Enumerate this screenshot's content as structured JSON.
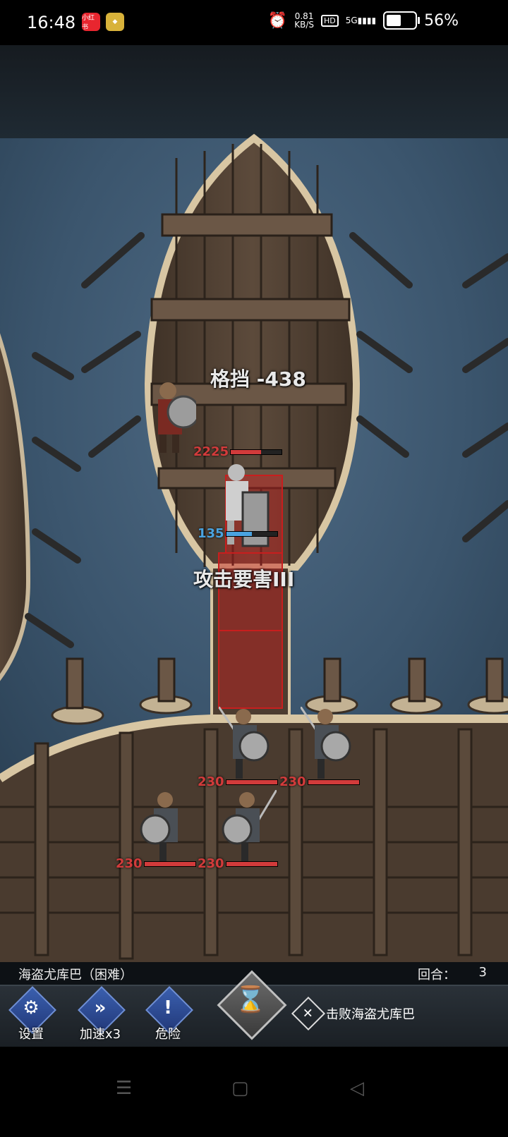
{
  "status_bar": {
    "time": "16:48",
    "app_badge_1": "小红书",
    "net_speed": "0.81",
    "net_unit": "KB/S",
    "hd": "HD",
    "signal": "5G",
    "battery_level": 56,
    "battery_text": "56%"
  },
  "battle": {
    "float_block": "格挡 -438",
    "float_skill": "攻击要害III",
    "hero_hp": "2225",
    "knight_hp": "135",
    "enemy_hp": [
      "230",
      "230",
      "230",
      "230"
    ]
  },
  "hud": {
    "level_name": "海盗尤库巴（困难）",
    "round_label": "回合：",
    "round_value": "3",
    "btn_settings": "设置",
    "btn_speed": "加速x3",
    "btn_danger": "危险",
    "objective": "击败海盗尤库巴",
    "icons": {
      "settings": "gear-icon",
      "speed": "fast-forward-icon",
      "danger": "exclamation-icon",
      "end_turn": "hourglass-icon",
      "objective": "crossed-swords-icon"
    }
  },
  "colors": {
    "hp_red": "#d23b3b",
    "hp_blue": "#4aa3e0",
    "hud_blue": "#3a5fae",
    "danger_tile": "#c81e1e"
  }
}
